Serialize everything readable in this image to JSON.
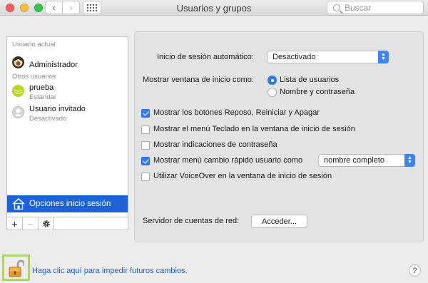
{
  "window": {
    "title": "Usuarios y grupos",
    "search_placeholder": "Buscar"
  },
  "sidebar": {
    "current_user_header": "Usuario actual",
    "current_user": {
      "name": "Administrador"
    },
    "other_users_header": "Otros usuarios",
    "other_users": [
      {
        "name": "prueba",
        "role": "Estándar"
      },
      {
        "name": "Usuario invitado",
        "role": "Desactivado"
      }
    ],
    "login_options_label": "Opciones inicio sesión",
    "toolbar": {
      "add": "+",
      "remove": "−"
    }
  },
  "panel": {
    "auto_login_label": "Inicio de sesión automático:",
    "auto_login_value": "Desactivado",
    "show_login_window_label": "Mostrar ventana de inicio como:",
    "login_window_options": [
      {
        "label": "Lista de usuarios",
        "selected": true
      },
      {
        "label": "Nombre y contraseña",
        "selected": false
      }
    ],
    "checkboxes": [
      {
        "label": "Mostrar los botones Reposo, Reiniciar y Apagar",
        "checked": true
      },
      {
        "label": "Mostrar el menú Teclado en la ventana de inicio de sesión",
        "checked": false
      },
      {
        "label": "Mostrar indicaciones de contraseña",
        "checked": false
      },
      {
        "label": "Mostrar menú cambio rápido usuario como",
        "checked": true
      },
      {
        "label": "Utilizar VoiceOver en la ventana de inicio de sesión",
        "checked": false
      }
    ],
    "fast_switch_value": "nombre completo",
    "network_server_label": "Servidor de cuentas de red:",
    "join_button": "Acceder..."
  },
  "footer": {
    "lock_text": "Haga clic aquí para impedir futuros cambios.",
    "help": "?"
  },
  "colors": {
    "selection": "#1d62d6",
    "accent": "#2f7bf5",
    "lock_highlight": "#a6e22e",
    "link": "#1f5fc6"
  }
}
